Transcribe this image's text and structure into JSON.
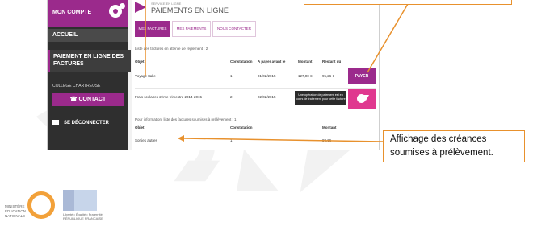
{
  "sidebar": {
    "account": "MON COMPTE",
    "home": "ACCUEIL",
    "payment": "PAIEMENT EN LIGNE DES FACTURES",
    "school": "COLLEGE CHARTREUSE",
    "contact": "CONTACT",
    "logout": "SE DÉCONNECTER"
  },
  "header": {
    "service": "SERVICE EN LIGNE",
    "title": "PAIEMENTS EN LIGNE"
  },
  "tabs": [
    "MES FACTURES",
    "MES PAIEMENTS",
    "NOUS CONTACTER"
  ],
  "invoices": {
    "intro": "Liste des factures en attente de règlement : 2",
    "columns": [
      "Objet",
      "Constatation",
      "A payer avant le",
      "Montant",
      "Restant dû"
    ],
    "rows": [
      [
        "Voyage Italie",
        "1",
        "01/02/2015",
        "127,00 €",
        "95,26 €"
      ],
      [
        "Frais scolaires 2ème trimestre 2014-2015",
        "2",
        "22/02/2015",
        "",
        ""
      ]
    ],
    "pay_button": "PAYER",
    "tooltip": "Une opération de paiement est en cours de traitement pour cette facture"
  },
  "debits": {
    "intro": "Pour information, liste des factures soumises à prélèvement : 1",
    "columns": [
      "Objet",
      "Constatation",
      "Montant"
    ],
    "rows": [
      [
        "Sorties autres",
        "1",
        "98,66"
      ]
    ]
  },
  "annotation": "Affichage des créances soumises à prélèvement.",
  "footer_logo": {
    "ministry": "MINISTÈRE ÉDUCATION NATIONALE",
    "republic": "Liberté • Égalité • Fraternité RÉPUBLIQUE FRANÇAISE"
  },
  "colors": {
    "accent": "#9b2a8c",
    "highlight": "#e0388f",
    "callout_border": "#e8912d"
  }
}
